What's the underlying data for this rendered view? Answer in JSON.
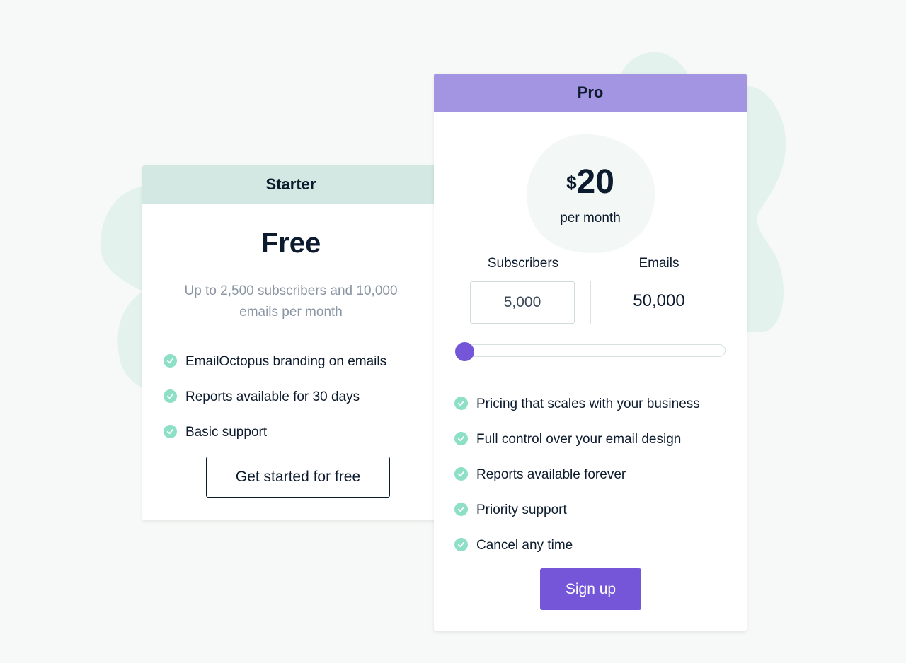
{
  "colors": {
    "accent": "#7556d9",
    "pro_header": "#a395e2",
    "starter_header": "#d3e8e2",
    "check": "#8ddfc6",
    "text": "#0d1b2e",
    "muted": "#8a96a3"
  },
  "starter": {
    "header": "Starter",
    "price": "Free",
    "description": "Up to 2,500 subscribers and 10,000 emails per month",
    "features": [
      "EmailOctopus branding on emails",
      "Reports available for 30 days",
      "Basic support"
    ],
    "button_label": "Get started for free"
  },
  "pro": {
    "header": "Pro",
    "price_currency": "$",
    "price_amount": "20",
    "price_period": "per month",
    "subscribers_label": "Subscribers",
    "subscribers_value": "5,000",
    "emails_label": "Emails",
    "emails_value": "50,000",
    "slider_fraction": 0.0,
    "features": [
      "Pricing that scales with your business",
      "Full control over your email design",
      "Reports available forever",
      "Priority support",
      "Cancel any time"
    ],
    "button_label": "Sign up"
  }
}
